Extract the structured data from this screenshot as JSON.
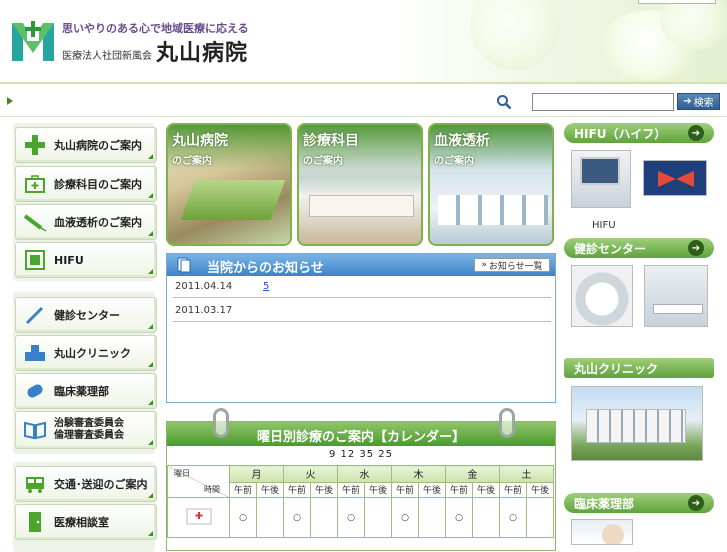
{
  "header": {
    "slogan": "思いやりのある心で地域医療に応える",
    "corporation": "医療法人社団新風会",
    "hospital_name": "丸山病院"
  },
  "search": {
    "placeholder": "",
    "button_label": "検索"
  },
  "nav": {
    "group1": [
      {
        "label": "丸山病院のご案内",
        "icon": "plus-icon"
      },
      {
        "label": "診療科目のご案内",
        "icon": "first-aid-kit-icon"
      },
      {
        "label": "血液透析のご案内",
        "icon": "syringe-icon"
      },
      {
        "label": "HIFU",
        "icon": "monitor-icon"
      }
    ],
    "group2": [
      {
        "label": "健診センター",
        "icon": "pen-icon"
      },
      {
        "label": "丸山クリニック",
        "icon": "building-icon"
      },
      {
        "label": "臨床薬理部",
        "icon": "pill-icon"
      },
      {
        "label_line1": "治験審査委員会",
        "label_line2": "倫理審査委員会",
        "icon": "book-icon"
      }
    ],
    "group3": [
      {
        "label": "交通･送迎のご案内",
        "icon": "bus-icon"
      },
      {
        "label": "医療相談室",
        "icon": "door-icon"
      }
    ]
  },
  "tiles": [
    {
      "title": "丸山病院",
      "subtitle": "のご案内"
    },
    {
      "title": "診療科目",
      "subtitle": "のご案内"
    },
    {
      "title": "血液透析",
      "subtitle": "のご案内"
    }
  ],
  "notice": {
    "title": "当院からのお知らせ",
    "all_button": "お知らせ一覧",
    "items": [
      {
        "date": "2011.04.14",
        "link": "5"
      },
      {
        "date": "2011.03.17",
        "link": ""
      }
    ]
  },
  "calendar": {
    "title": "曜日別診療のご案内【カレンダー】",
    "subtitle": "9 12 35 25",
    "corner_top": "曜日",
    "corner_bottom": "時間",
    "days": [
      "月",
      "火",
      "水",
      "木",
      "金",
      "土"
    ],
    "am": "午前",
    "pm": "午後",
    "mark": "○"
  },
  "right": {
    "hifu_header": "HIFU（ハイフ）",
    "hifu_caption": "HIFU",
    "kenshin_header": "健診センター",
    "clinic_header": "丸山クリニック",
    "pharm_header": "臨床薬理部",
    "go_icon": "arrow-right-icon"
  },
  "colors": {
    "brand_green": "#4b9a2c",
    "notice_blue": "#3d83c8",
    "logo_purple": "#6a4d8f"
  }
}
